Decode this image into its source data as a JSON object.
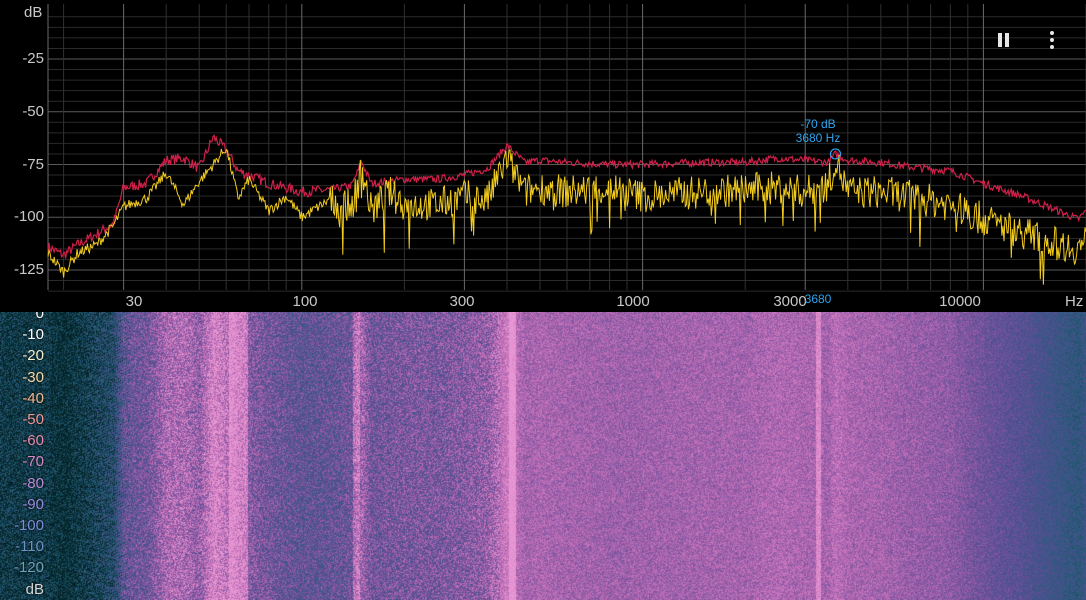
{
  "spectrum": {
    "y_unit": "dB",
    "x_unit": "Hz",
    "y_ticks": [
      "-25",
      "-50",
      "-75",
      "-100",
      "-125"
    ],
    "x_ticks": [
      "30",
      "100",
      "300",
      "1000",
      "3000",
      "10000"
    ],
    "peak": {
      "level_label": "-70 dB",
      "freq_label": "3680 Hz",
      "axis_label": "3680"
    }
  },
  "controls": {
    "pause_icon": "pause-icon",
    "menu_icon": "more-vert-icon"
  },
  "spectrogram": {
    "scale_labels": [
      "0",
      "-10",
      "-20",
      "-30",
      "-40",
      "-50",
      "-60",
      "-70",
      "-80",
      "-90",
      "-100",
      "-110",
      "-120",
      "dB"
    ],
    "scale_colors": [
      "#ffffff",
      "#ffffff",
      "#f4f0d4",
      "#f7d9a4",
      "#f4b88f",
      "#f29b9a",
      "#e78bb0",
      "#d68bc8",
      "#b98bd8",
      "#9b8ae0",
      "#7f8ed8",
      "#6a95c8",
      "#6aa3b8",
      "#d8d8d8"
    ]
  },
  "chart_data": {
    "type": "line",
    "x_scale": "log",
    "xlim": [
      18,
      20000
    ],
    "ylim": [
      -135,
      0
    ],
    "xlabel": "Hz",
    "ylabel": "dB",
    "grid": true,
    "series": [
      {
        "color": "#d0204a",
        "x": [
          18,
          20,
          22,
          25,
          28,
          30,
          35,
          40,
          45,
          50,
          55,
          60,
          65,
          70,
          80,
          90,
          100,
          120,
          140,
          150,
          160,
          180,
          200,
          250,
          300,
          350,
          400,
          450,
          500,
          600,
          800,
          1000,
          1500,
          2000,
          2500,
          3000,
          3500,
          3680,
          4000,
          5000,
          6000,
          8000,
          10000,
          13000,
          16000,
          19000,
          20000
        ],
        "y": [
          -114,
          -118,
          -113,
          -108,
          -103,
          -86,
          -84,
          -73,
          -72,
          -77,
          -62,
          -68,
          -78,
          -80,
          -84,
          -86,
          -88,
          -87,
          -85,
          -74,
          -84,
          -83,
          -82,
          -82,
          -80,
          -77,
          -66,
          -74,
          -73,
          -74,
          -75,
          -75,
          -74,
          -74,
          -72,
          -73,
          -74,
          -70,
          -73,
          -74,
          -76,
          -78,
          -84,
          -90,
          -96,
          -101,
          -97
        ]
      },
      {
        "color": "#f2cc1c",
        "x": [
          18,
          20,
          22,
          25,
          28,
          30,
          35,
          40,
          45,
          50,
          55,
          60,
          65,
          70,
          80,
          90,
          100,
          120,
          140,
          150,
          160,
          180,
          200,
          250,
          300,
          350,
          400,
          450,
          500,
          600,
          800,
          1000,
          1500,
          2000,
          2500,
          3000,
          3500,
          3680,
          4000,
          5000,
          6000,
          8000,
          10000,
          13000,
          16000,
          19000,
          20000
        ],
        "y": [
          -117,
          -126,
          -117,
          -113,
          -104,
          -95,
          -91,
          -79,
          -94,
          -83,
          -75,
          -67,
          -91,
          -82,
          -97,
          -90,
          -100,
          -92,
          -95,
          -77,
          -97,
          -88,
          -94,
          -94,
          -90,
          -92,
          -72,
          -88,
          -86,
          -88,
          -86,
          -90,
          -88,
          -87,
          -86,
          -88,
          -85,
          -73,
          -88,
          -88,
          -90,
          -94,
          -101,
          -107,
          -112,
          -115,
          -110
        ]
      }
    ]
  }
}
